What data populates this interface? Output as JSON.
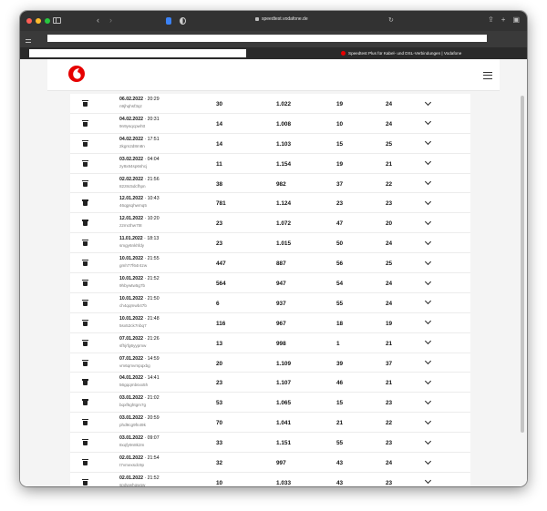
{
  "browser": {
    "url": "speedtest.vodafone.de",
    "tab_title": "Speedtest Plus für Kabel- und DSL-Verbindungen | Vodafone"
  },
  "colors": {
    "brand": "#e60000",
    "titlebar": "#323232",
    "page_bg": "#f4f4f4"
  },
  "icons": {
    "logo": "vodafone-logo",
    "menu": "hamburger-icon",
    "delete": "trash-icon",
    "expand": "chevron-down-icon"
  },
  "rows": [
    {
      "date": "06.02.2022",
      "time": "20:29",
      "id": "n9jhqhsf3qz",
      "ping": "30",
      "down": "1.022",
      "up": "19",
      "jitter": "24"
    },
    {
      "date": "04.02.2022",
      "time": "20:31",
      "id": "9n9ysqcpwhtt",
      "ping": "14",
      "down": "1.008",
      "up": "10",
      "jitter": "24"
    },
    {
      "date": "04.02.2022",
      "time": "17:51",
      "id": "2kgm2d8m8n",
      "ping": "14",
      "down": "1.103",
      "up": "15",
      "jitter": "25"
    },
    {
      "date": "03.02.2022",
      "time": "04:04",
      "id": "zy8x84sp6shcj",
      "ping": "11",
      "down": "1.154",
      "up": "19",
      "jitter": "21"
    },
    {
      "date": "02.02.2022",
      "time": "21:56",
      "id": "82z8c5dcfhpn",
      "ping": "38",
      "down": "982",
      "up": "37",
      "jitter": "22"
    },
    {
      "date": "12.01.2022",
      "time": "10:43",
      "id": "46qgsqhwmq5",
      "ping": "781",
      "down": "1.124",
      "up": "23",
      "jitter": "23"
    },
    {
      "date": "12.01.2022",
      "time": "10:20",
      "id": "z2mcthw7t8",
      "ping": "23",
      "down": "1.072",
      "up": "47",
      "jitter": "20"
    },
    {
      "date": "11.01.2022",
      "time": "18:13",
      "id": "smgy6nkhfdy",
      "ping": "23",
      "down": "1.015",
      "up": "50",
      "jitter": "24"
    },
    {
      "date": "10.01.2022",
      "time": "21:55",
      "id": "gmh77f64r4zw",
      "ping": "447",
      "down": "887",
      "up": "56",
      "jitter": "25"
    },
    {
      "date": "10.01.2022",
      "time": "21:52",
      "id": "9hbywtw5g7b",
      "ping": "564",
      "down": "947",
      "up": "54",
      "jitter": "24"
    },
    {
      "date": "10.01.2022",
      "time": "21:50",
      "id": "ch4qqmwb47b",
      "ping": "6",
      "down": "937",
      "up": "55",
      "jitter": "24"
    },
    {
      "date": "10.01.2022",
      "time": "21:48",
      "id": "5sx52ck7nbq7",
      "ping": "116",
      "down": "967",
      "up": "18",
      "jitter": "19"
    },
    {
      "date": "07.01.2022",
      "time": "21:26",
      "id": "sfhjrfg6yypmw",
      "ping": "13",
      "down": "998",
      "up": "1",
      "jitter": "21"
    },
    {
      "date": "07.01.2022",
      "time": "14:59",
      "id": "vm6qmvmpqxbg",
      "ping": "20",
      "down": "1.109",
      "up": "39",
      "jitter": "37"
    },
    {
      "date": "04.01.2022",
      "time": "14:41",
      "id": "56gqqmbsxx5h",
      "ping": "23",
      "down": "1.107",
      "up": "46",
      "jitter": "21"
    },
    {
      "date": "03.01.2022",
      "time": "21:02",
      "id": "bqxf5ghtgm7g",
      "ping": "53",
      "down": "1.065",
      "up": "15",
      "jitter": "23"
    },
    {
      "date": "03.01.2022",
      "time": "20:59",
      "id": "phd9cg9fn49k",
      "ping": "70",
      "down": "1.041",
      "up": "21",
      "jitter": "22"
    },
    {
      "date": "03.01.2022",
      "time": "09:07",
      "id": "8xqfy9n8k2m",
      "ping": "33",
      "down": "1.151",
      "up": "55",
      "jitter": "23"
    },
    {
      "date": "02.01.2022",
      "time": "21:54",
      "id": "t7vmexsdc9p",
      "ping": "32",
      "down": "997",
      "up": "43",
      "jitter": "24"
    },
    {
      "date": "02.01.2022",
      "time": "21:52",
      "id": "spdwwhqwgw",
      "ping": "10",
      "down": "1.033",
      "up": "43",
      "jitter": "23"
    }
  ]
}
